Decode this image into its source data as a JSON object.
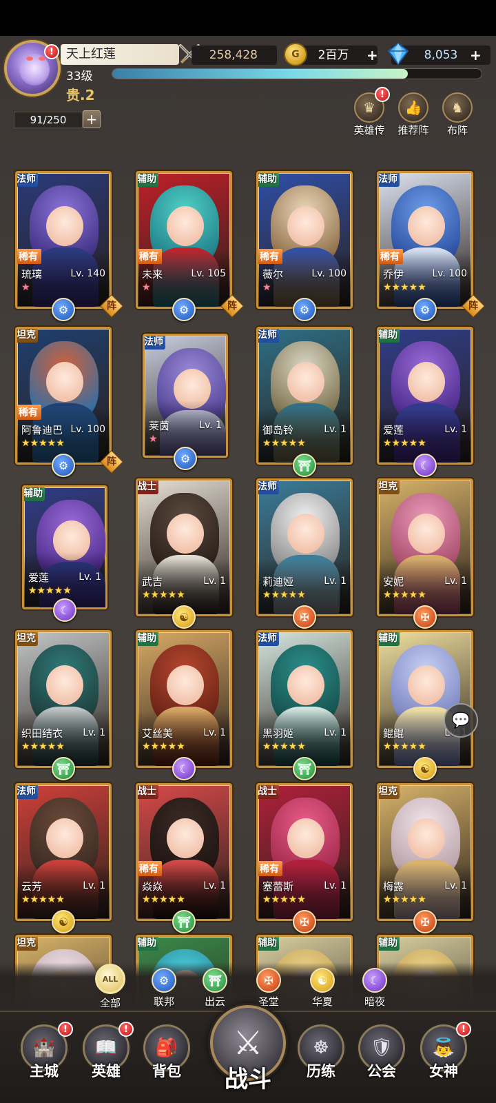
{
  "header": {
    "player_name": "天上红莲",
    "combat_power": "258,428",
    "gold": "2百万",
    "gems": "8,053",
    "plus": "+",
    "level": "33级",
    "vip": "贵.2",
    "exp_fraction": 0.8,
    "alert": "!"
  },
  "roster": {
    "count": "91/250",
    "plus": "+"
  },
  "quick_buttons": [
    {
      "label": "英雄传",
      "icon": "crown-icon"
    },
    {
      "label": "推荐阵",
      "icon": "thumbs-up-icon"
    },
    {
      "label": "布阵",
      "icon": "chess-knight-icon"
    }
  ],
  "heroes": [
    {
      "name": "琉璃",
      "lv": "Lv. 140",
      "role": "法师",
      "rare": "稀有",
      "stars": "★",
      "star_color": "pink",
      "faction": "联邦",
      "formation": "阵"
    },
    {
      "name": "未来",
      "lv": "Lv. 105",
      "role": "辅助",
      "rare": "稀有",
      "stars": "★",
      "star_color": "pink",
      "faction": "联邦",
      "formation": "阵"
    },
    {
      "name": "薇尔",
      "lv": "Lv. 100",
      "role": "辅助",
      "rare": "稀有",
      "stars": "★",
      "star_color": "pink",
      "faction": "联邦",
      "formation": ""
    },
    {
      "name": "乔伊",
      "lv": "Lv. 100",
      "role": "法师",
      "rare": "稀有",
      "stars": "★★★★★",
      "star_color": "gold",
      "faction": "联邦",
      "formation": "阵"
    },
    {
      "name": "阿鲁迪巴",
      "lv": "Lv. 100",
      "role": "坦克",
      "rare": "稀有",
      "stars": "★★★★★",
      "star_color": "gold",
      "faction": "联邦",
      "formation": "阵"
    },
    {
      "name": "莱茵",
      "lv": "Lv. 1",
      "role": "法师",
      "rare": "",
      "stars": "★",
      "star_color": "pink",
      "faction": "联邦",
      "formation": ""
    },
    {
      "name": "御岛铃",
      "lv": "Lv. 1",
      "role": "法师",
      "rare": "",
      "stars": "★★★★★",
      "star_color": "gold",
      "faction": "出云",
      "formation": ""
    },
    {
      "name": "爱莲",
      "lv": "Lv. 1",
      "role": "辅助",
      "rare": "",
      "stars": "★★★★★",
      "star_color": "gold",
      "faction": "暗夜",
      "formation": ""
    },
    {
      "name": "爱莲",
      "lv": "Lv. 1",
      "role": "辅助",
      "rare": "",
      "stars": "★★★★★",
      "star_color": "gold",
      "faction": "暗夜",
      "formation": ""
    },
    {
      "name": "武吉",
      "lv": "Lv. 1",
      "role": "战士",
      "rare": "",
      "stars": "★★★★★",
      "star_color": "gold",
      "faction": "华夏",
      "formation": ""
    },
    {
      "name": "莉迪娅",
      "lv": "Lv. 1",
      "role": "法师",
      "rare": "",
      "stars": "★★★★★",
      "star_color": "gold",
      "faction": "圣堂",
      "formation": ""
    },
    {
      "name": "安妮",
      "lv": "Lv. 1",
      "role": "坦克",
      "rare": "",
      "stars": "★★★★★",
      "star_color": "gold",
      "faction": "圣堂",
      "formation": ""
    },
    {
      "name": "织田结衣",
      "lv": "Lv. 1",
      "role": "坦克",
      "rare": "",
      "stars": "★★★★★",
      "star_color": "gold",
      "faction": "出云",
      "formation": ""
    },
    {
      "name": "艾丝美",
      "lv": "Lv. 1",
      "role": "辅助",
      "rare": "",
      "stars": "★★★★★",
      "star_color": "gold",
      "faction": "暗夜",
      "formation": ""
    },
    {
      "name": "黑羽姬",
      "lv": "Lv. 1",
      "role": "法师",
      "rare": "",
      "stars": "★★★★★",
      "star_color": "gold",
      "faction": "出云",
      "formation": ""
    },
    {
      "name": "鲲鲲",
      "lv": "Lv. 1",
      "role": "辅助",
      "rare": "",
      "stars": "★★★★★",
      "star_color": "gold",
      "faction": "华夏",
      "formation": ""
    },
    {
      "name": "云芳",
      "lv": "Lv. 1",
      "role": "法师",
      "rare": "",
      "stars": "★★★★★",
      "star_color": "gold",
      "faction": "华夏",
      "formation": ""
    },
    {
      "name": "焱焱",
      "lv": "Lv. 1",
      "role": "战士",
      "rare": "稀有",
      "stars": "★★★★★",
      "star_color": "gold",
      "faction": "出云",
      "formation": ""
    },
    {
      "name": "塞蕾斯",
      "lv": "Lv. 1",
      "role": "战士",
      "rare": "稀有",
      "stars": "★★★★★",
      "star_color": "gold",
      "faction": "圣堂",
      "formation": ""
    },
    {
      "name": "梅露",
      "lv": "Lv. 1",
      "role": "坦克",
      "rare": "",
      "stars": "★★★★★",
      "star_color": "gold",
      "faction": "圣堂",
      "formation": ""
    },
    {
      "name": "",
      "lv": "",
      "role": "坦克",
      "rare": "",
      "stars": "",
      "star_color": "gold",
      "faction": "",
      "formation": ""
    },
    {
      "name": "",
      "lv": "",
      "role": "辅助",
      "rare": "",
      "stars": "",
      "star_color": "gold",
      "faction": "",
      "formation": ""
    },
    {
      "name": "",
      "lv": "",
      "role": "辅助",
      "rare": "",
      "stars": "",
      "star_color": "gold",
      "faction": "",
      "formation": ""
    },
    {
      "name": "",
      "lv": "",
      "role": "辅助",
      "rare": "",
      "stars": "",
      "star_color": "gold",
      "faction": "",
      "formation": ""
    }
  ],
  "filters": [
    {
      "label": "全部",
      "icon_text": "ALL",
      "active": true
    },
    {
      "label": "联邦",
      "icon_text": "⚙",
      "active": false
    },
    {
      "label": "出云",
      "icon_text": "⛩",
      "active": false
    },
    {
      "label": "圣堂",
      "icon_text": "✠",
      "active": false
    },
    {
      "label": "华夏",
      "icon_text": "☯",
      "active": false
    },
    {
      "label": "暗夜",
      "icon_text": "☾",
      "active": false
    }
  ],
  "nav": {
    "main_city": "主城",
    "heroes": "英雄",
    "bag": "背包",
    "battle": "战斗",
    "training": "历练",
    "guild": "公会",
    "goddess": "女神"
  },
  "colors": {
    "accent_gold": "#c8913a",
    "alert_red": "#d21b1b",
    "exp_blue": "#79d8e8"
  }
}
